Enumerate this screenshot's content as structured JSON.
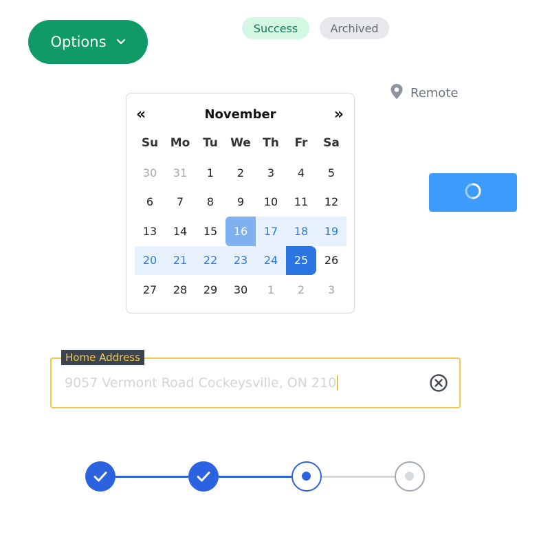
{
  "options_button": {
    "label": "Options",
    "icon": "chevron-down-icon"
  },
  "badges": {
    "success": "Success",
    "archived": "Archived"
  },
  "location": {
    "icon": "map-pin-icon",
    "label": "Remote"
  },
  "calendar": {
    "month": "November",
    "prev_icon": "double-chevron-left-icon",
    "next_icon": "double-chevron-right-icon",
    "weekdays": [
      "Su",
      "Mo",
      "Tu",
      "We",
      "Th",
      "Fr",
      "Sa"
    ],
    "weeks": [
      [
        "30",
        "31",
        "1",
        "2",
        "3",
        "4",
        "5"
      ],
      [
        "6",
        "7",
        "8",
        "9",
        "10",
        "11",
        "12"
      ],
      [
        "13",
        "14",
        "15",
        "16",
        "17",
        "18",
        "19"
      ],
      [
        "20",
        "21",
        "22",
        "23",
        "24",
        "25",
        "26"
      ],
      [
        "27",
        "28",
        "29",
        "30",
        "1",
        "2",
        "3"
      ]
    ],
    "range_start": "16",
    "range_end": "25"
  },
  "loading_button": {
    "icon": "spinner-icon"
  },
  "address": {
    "label": "Home Address",
    "value": "9057 Vermont Road Cockeysville, ON 210",
    "clear_icon": "clear-circle-icon"
  },
  "stepper": {
    "steps": [
      {
        "state": "complete"
      },
      {
        "state": "complete"
      },
      {
        "state": "active"
      },
      {
        "state": "pending"
      }
    ]
  },
  "colors": {
    "primary_green": "#0f9a66",
    "primary_blue": "#2a62e0",
    "loading_blue": "#3d9bfb",
    "warning_yellow": "#f0c94a"
  }
}
